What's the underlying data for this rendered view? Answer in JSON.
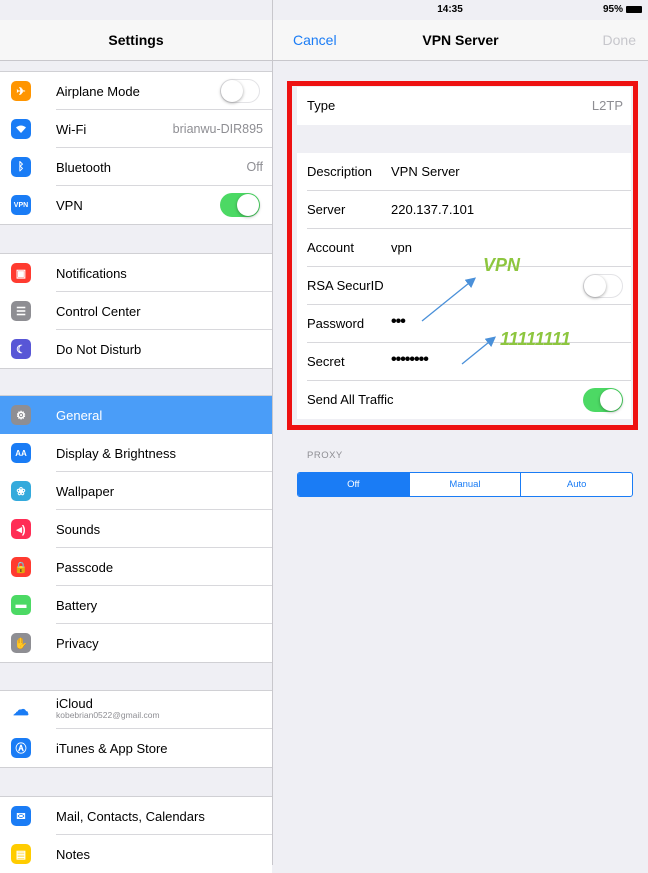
{
  "status_bar": {
    "device": "iPad",
    "time": "14:35",
    "battery": "95%"
  },
  "left_pane": {
    "title": "Settings",
    "groups": [
      [
        {
          "icon": "airplane-icon",
          "color": "#ff9500",
          "label": "Airplane Mode",
          "toggle": "off"
        },
        {
          "icon": "wifi-icon",
          "color": "#1a7cf5",
          "label": "Wi-Fi",
          "value": "brianwu-DIR895"
        },
        {
          "icon": "bluetooth-icon",
          "color": "#1a7cf5",
          "label": "Bluetooth",
          "value": "Off"
        },
        {
          "icon": "vpn-icon",
          "icon_text": "VPN",
          "color": "#1a7cf5",
          "label": "VPN",
          "toggle": "on"
        }
      ],
      [
        {
          "icon": "notifications-icon",
          "color": "#ff3b30",
          "label": "Notifications"
        },
        {
          "icon": "control-center-icon",
          "color": "#8e8e93",
          "label": "Control Center"
        },
        {
          "icon": "moon-icon",
          "color": "#5856d6",
          "label": "Do Not Disturb"
        }
      ],
      [
        {
          "icon": "gear-icon",
          "color": "#8e8e93",
          "label": "General",
          "selected": true
        },
        {
          "icon": "display-icon",
          "icon_text": "AA",
          "color": "#1a7cf5",
          "label": "Display & Brightness"
        },
        {
          "icon": "wallpaper-icon",
          "color": "#34aadc",
          "label": "Wallpaper"
        },
        {
          "icon": "sounds-icon",
          "color": "#ff2d55",
          "label": "Sounds"
        },
        {
          "icon": "lock-icon",
          "color": "#ff3b30",
          "label": "Passcode"
        },
        {
          "icon": "battery-icon",
          "color": "#4cd964",
          "label": "Battery"
        },
        {
          "icon": "hand-icon",
          "color": "#8e8e93",
          "label": "Privacy"
        }
      ],
      [
        {
          "icon": "icloud-icon",
          "color": "#ffffff",
          "label": "iCloud",
          "sub": "kobebrian0522@gmail.com"
        },
        {
          "icon": "app-store-icon",
          "color": "#1a7cf5",
          "label": "iTunes & App Store"
        }
      ],
      [
        {
          "icon": "mail-icon",
          "color": "#1a7cf5",
          "label": "Mail, Contacts, Calendars"
        },
        {
          "icon": "notes-icon",
          "color": "#ffcc00",
          "label": "Notes"
        }
      ]
    ]
  },
  "right_pane": {
    "cancel": "Cancel",
    "title": "VPN Server",
    "done": "Done",
    "type": {
      "label": "Type",
      "value": "L2TP"
    },
    "fields": [
      {
        "label": "Description",
        "value": "VPN Server"
      },
      {
        "label": "Server",
        "value": "220.137.7.101"
      },
      {
        "label": "Account",
        "value": "vpn"
      },
      {
        "label": "RSA SecurID",
        "toggle": "off"
      },
      {
        "label": "Password",
        "value": "•••"
      },
      {
        "label": "Secret",
        "value": "••••••••"
      },
      {
        "label": "Send All Traffic",
        "toggle": "on"
      }
    ],
    "proxy": {
      "label": "PROXY",
      "options": [
        "Off",
        "Manual",
        "Auto"
      ],
      "selected": "Off"
    }
  },
  "annotations": {
    "password_hint": "VPN",
    "secret_hint": "11111111",
    "color": "#8dc63f"
  }
}
